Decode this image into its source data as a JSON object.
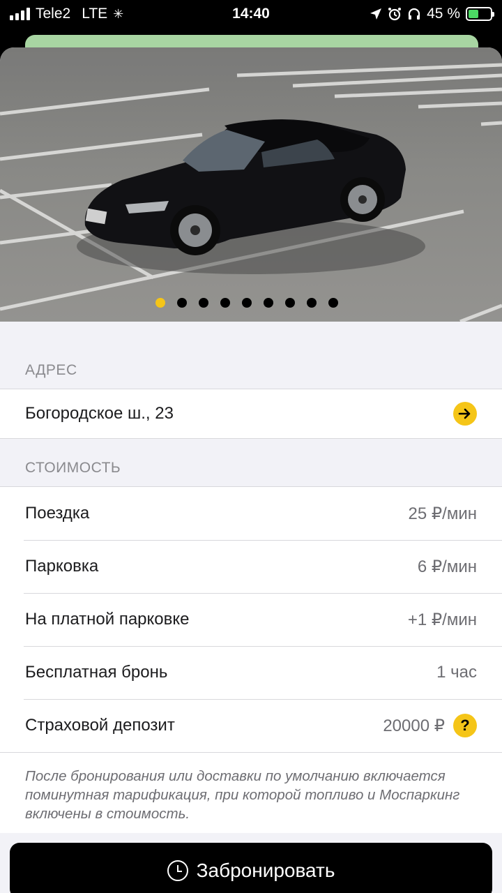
{
  "status_bar": {
    "carrier": "Tele2",
    "network": "LTE",
    "time": "14:40",
    "battery_percent": "45 %",
    "icons": [
      "signal-icon",
      "loading-icon",
      "location-icon",
      "alarm-icon",
      "headphones-icon",
      "battery-charging-icon"
    ]
  },
  "gallery": {
    "total_photos": 9,
    "active_index": 0,
    "active_color": "#f5c518",
    "photo_subject": "car-photo"
  },
  "address": {
    "header": "АДРЕС",
    "value": "Богородское ш., 23",
    "action_icon": "arrow-right-icon"
  },
  "cost": {
    "header": "СТОИМОСТЬ",
    "rows": [
      {
        "label": "Поездка",
        "value": "25 ₽/мин"
      },
      {
        "label": "Парковка",
        "value": "6 ₽/мин"
      },
      {
        "label": "На платной парковке",
        "value": "+1 ₽/мин"
      },
      {
        "label": "Бесплатная бронь",
        "value": "1 час"
      },
      {
        "label": "Страховой депозит",
        "value": "20000 ₽"
      }
    ],
    "help_symbol": "?",
    "note": "После бронирования или доставки по умолчанию включается поминутная тарификация, при которой топливо и Моспаркинг включены в стоимость."
  },
  "actions": {
    "book_label": "Забронировать"
  },
  "colors": {
    "accent": "#f5c518",
    "background": "#f2f2f7",
    "button": "#000000"
  }
}
